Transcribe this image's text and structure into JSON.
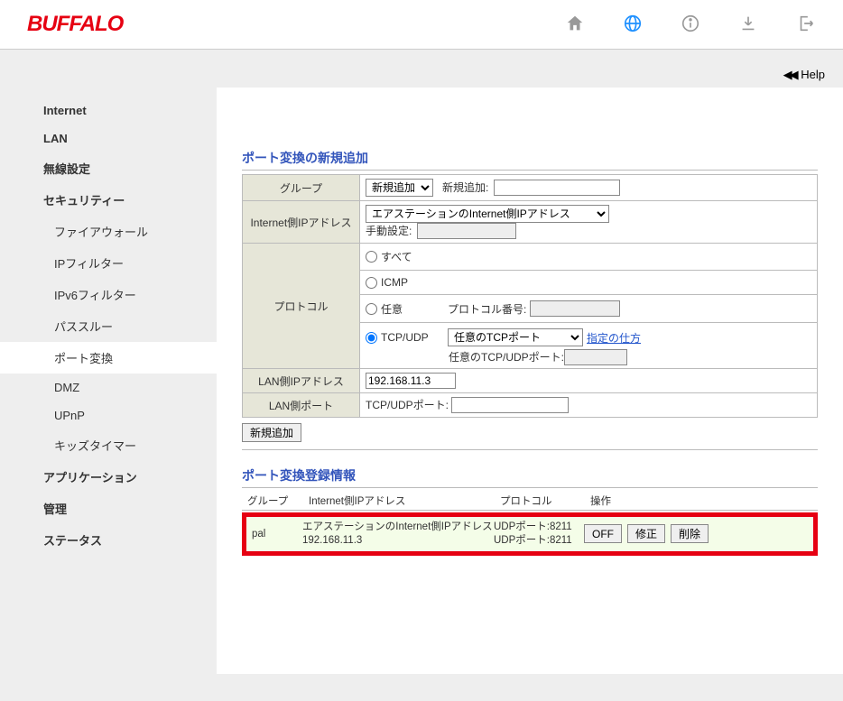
{
  "brand": "BUFFALO",
  "help": "Help",
  "nav": {
    "internet": "Internet",
    "lan": "LAN",
    "wireless": "無線設定",
    "security": "セキュリティー",
    "firewall": "ファイアウォール",
    "ipfilter": "IPフィルター",
    "ipv6filter": "IPv6フィルター",
    "passthrough": "パススルー",
    "portfwd": "ポート変換",
    "dmz": "DMZ",
    "upnp": "UPnP",
    "kidstimer": "キッズタイマー",
    "application": "アプリケーション",
    "admin": "管理",
    "status": "ステータス"
  },
  "form": {
    "title1": "ポート変換の新規追加",
    "group": "グループ",
    "group_select": "新規追加",
    "group_new_label": "新規追加:",
    "wan_ip": "Internet側IPアドレス",
    "wan_ip_select": "エアステーションのInternet側IPアドレス",
    "wan_manual_label": "手動設定:",
    "protocol": "プロトコル",
    "proto_all": "すべて",
    "proto_icmp": "ICMP",
    "proto_any": "任意",
    "proto_num_label": "プロトコル番号:",
    "proto_tcpudp": "TCP/UDP",
    "tcpport_select": "任意のTCPポート",
    "howto": "指定の仕方",
    "tcpudp_port_label": "任意のTCP/UDPポート:",
    "lan_ip": "LAN側IPアドレス",
    "lan_ip_value": "192.168.11.3",
    "lan_port": "LAN側ポート",
    "lan_port_label": "TCP/UDPポート:",
    "add_btn": "新規追加"
  },
  "reg": {
    "title": "ポート変換登録情報",
    "h_group": "グループ",
    "h_wan": "Internet側IPアドレス",
    "h_proto": "プロトコル",
    "h_action": "操作",
    "row": {
      "group": "pal",
      "wan1": "エアステーションのInternet側IPアドレス",
      "wan2": "192.168.11.3",
      "proto1": "UDPポート:8211",
      "proto2": "UDPポート:8211",
      "off": "OFF",
      "edit": "修正",
      "del": "削除"
    }
  }
}
